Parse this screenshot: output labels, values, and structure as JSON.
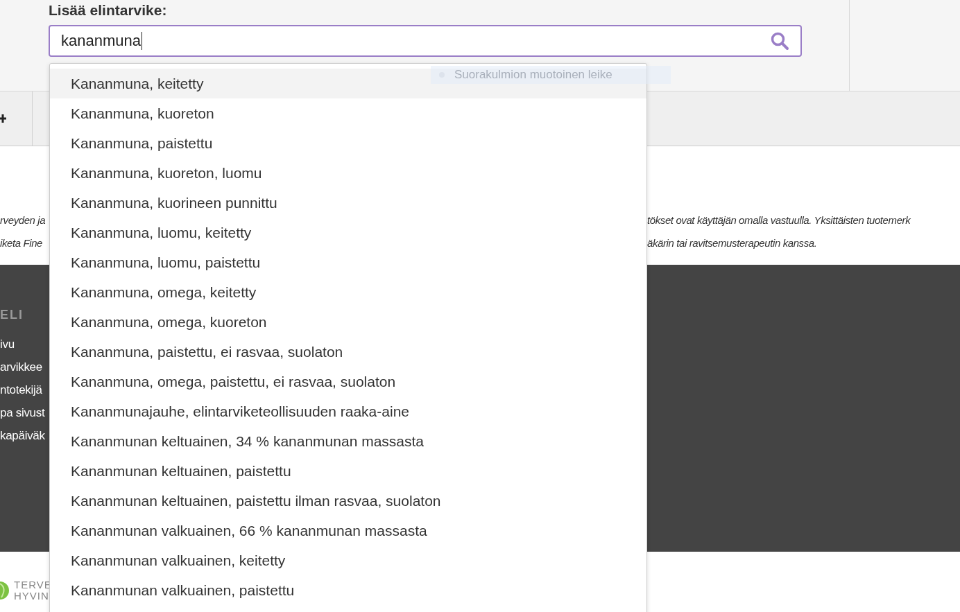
{
  "form": {
    "label": "Lisää elintarvike:",
    "search": {
      "value": "kananmuna"
    }
  },
  "disclaimer": {
    "left_lines": [
      "rveyden ja",
      "iketa Fine"
    ],
    "right_lines": [
      "tökset ovat käyttäjän omalla vastuulla. Yksittäisten tuotemerk",
      "äkärin tai ravitsemusterapeutin kanssa."
    ]
  },
  "footer": {
    "heading": "ELI",
    "links": [
      "ivu",
      "arvikkee",
      "ntotekijä",
      "pa sivust",
      "kapäiväk"
    ]
  },
  "logo": {
    "lines": [
      "TERVE",
      "HYVIN"
    ]
  },
  "tooltip": {
    "text": "Suorakulmion muotoinen leike"
  },
  "suggestions": [
    {
      "label": "Kananmuna, keitetty",
      "selected": true
    },
    {
      "label": "Kananmuna, kuoreton",
      "selected": false
    },
    {
      "label": "Kananmuna, paistettu",
      "selected": false
    },
    {
      "label": "Kananmuna, kuoreton, luomu",
      "selected": false
    },
    {
      "label": "Kananmuna, kuorineen punnittu",
      "selected": false
    },
    {
      "label": "Kananmuna, luomu, keitetty",
      "selected": false
    },
    {
      "label": "Kananmuna, luomu, paistettu",
      "selected": false
    },
    {
      "label": "Kananmuna, omega, keitetty",
      "selected": false
    },
    {
      "label": "Kananmuna, omega, kuoreton",
      "selected": false
    },
    {
      "label": "Kananmuna, paistettu, ei rasvaa, suolaton",
      "selected": false
    },
    {
      "label": "Kananmuna, omega, paistettu, ei rasvaa, suolaton",
      "selected": false
    },
    {
      "label": "Kananmunajauhe, elintarviketeollisuuden raaka-aine",
      "selected": false
    },
    {
      "label": "Kananmunan keltuainen, 34 % kananmunan massasta",
      "selected": false
    },
    {
      "label": "Kananmunan keltuainen, paistettu",
      "selected": false
    },
    {
      "label": "Kananmunan keltuainen, paistettu ilman rasvaa, suolaton",
      "selected": false
    },
    {
      "label": "Kananmunan valkuainen, 66 % kananmunan massasta",
      "selected": false
    },
    {
      "label": "Kananmunan valkuainen, keitetty",
      "selected": false
    },
    {
      "label": "Kananmunan valkuainen, paistettu",
      "selected": false
    }
  ]
}
